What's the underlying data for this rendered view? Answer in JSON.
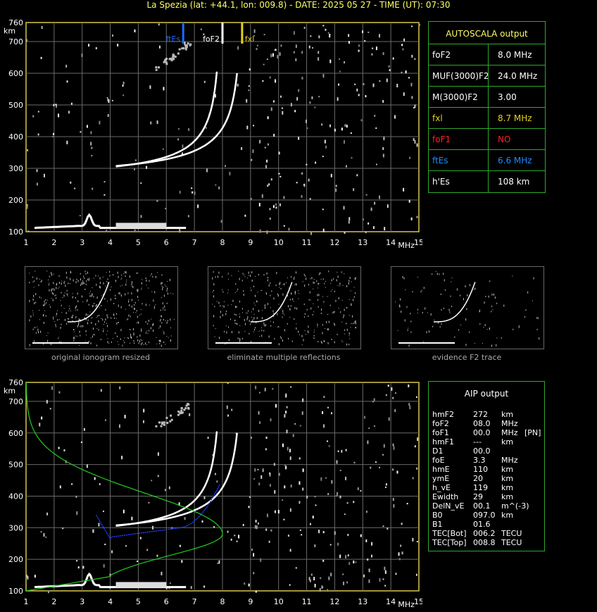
{
  "title": "La Spezia (lat: +44.1, lon: 009.8) - DATE: 2025 05 27 - TIME (UT): 07:30",
  "axes": {
    "y_unit": "km",
    "x_unit": "MHz",
    "y_ticks": [
      "760",
      "700",
      "600",
      "500",
      "400",
      "300",
      "200",
      "100"
    ],
    "x_ticks": [
      "1",
      "2",
      "3",
      "4",
      "5",
      "6",
      "7",
      "8",
      "9",
      "10",
      "11",
      "12",
      "13",
      "14",
      "15"
    ]
  },
  "markers": {
    "ftEs": {
      "label": "ftEs",
      "freq": 6.6,
      "color": "#1a6cff"
    },
    "foF2": {
      "label": "foF2",
      "freq": 8.0,
      "color": "#ffffff"
    },
    "fxl": {
      "label": "fxl",
      "freq": 8.7,
      "color": "#e6d21a"
    }
  },
  "autoscala": {
    "header": "AUTOSCALA output",
    "rows": [
      {
        "name": "foF2",
        "value": "8.0 MHz",
        "color": "#ffffff"
      },
      {
        "name": "MUF(3000)F2",
        "value": "24.0 MHz",
        "color": "#ffffff"
      },
      {
        "name": "M(3000)F2",
        "value": "3.00",
        "color": "#ffffff"
      },
      {
        "name": "fxl",
        "value": "8.7 MHz",
        "color": "#e6d21a"
      },
      {
        "name": "foF1",
        "value": "NO",
        "color": "#ff2020"
      },
      {
        "name": "ftEs",
        "value": "6.6 MHz",
        "color": "#1a8cff"
      },
      {
        "name": "h'Es",
        "value": "108    km",
        "color": "#ffffff"
      }
    ]
  },
  "thumbnails": [
    {
      "caption": "original ionogram resized"
    },
    {
      "caption": "eliminate multiple reflections"
    },
    {
      "caption": "evidence F2 trace"
    }
  ],
  "aip": {
    "header": "AIP output",
    "rows": [
      {
        "name": "hmF2",
        "value": "272",
        "unit": "km",
        "extra": ""
      },
      {
        "name": "foF2",
        "value": "08.0",
        "unit": "MHz",
        "extra": ""
      },
      {
        "name": "foF1",
        "value": "00.0",
        "unit": "MHz",
        "extra": "[PN]"
      },
      {
        "name": "hmF1",
        "value": "---",
        "unit": "km",
        "extra": ""
      },
      {
        "name": "D1",
        "value": "00.0",
        "unit": "",
        "extra": ""
      },
      {
        "name": "foE",
        "value": "3.3",
        "unit": "MHz",
        "extra": ""
      },
      {
        "name": "hmE",
        "value": "110",
        "unit": "km",
        "extra": ""
      },
      {
        "name": "ymE",
        "value": "20",
        "unit": "km",
        "extra": ""
      },
      {
        "name": "h_vE",
        "value": "119",
        "unit": "km",
        "extra": ""
      },
      {
        "name": "Ewidth",
        "value": "29",
        "unit": "km",
        "extra": ""
      },
      {
        "name": "DelN_vE",
        "value": "00.1",
        "unit": "m^(-3)",
        "extra": ""
      },
      {
        "name": "B0",
        "value": "097.0",
        "unit": "km",
        "extra": ""
      },
      {
        "name": "B1",
        "value": "01.6",
        "unit": "",
        "extra": ""
      },
      {
        "name": "TEC[Bot]",
        "value": "006.2",
        "unit": "TECU",
        "extra": ""
      },
      {
        "name": "TEC[Top]",
        "value": "008.8",
        "unit": "TECU",
        "extra": ""
      }
    ]
  },
  "colors": {
    "axis": "#d6c64a",
    "grid": "#6a6a6a",
    "trace": "#ffffff",
    "profile": "#22cc22",
    "aip_trace": "#2040ff"
  }
}
